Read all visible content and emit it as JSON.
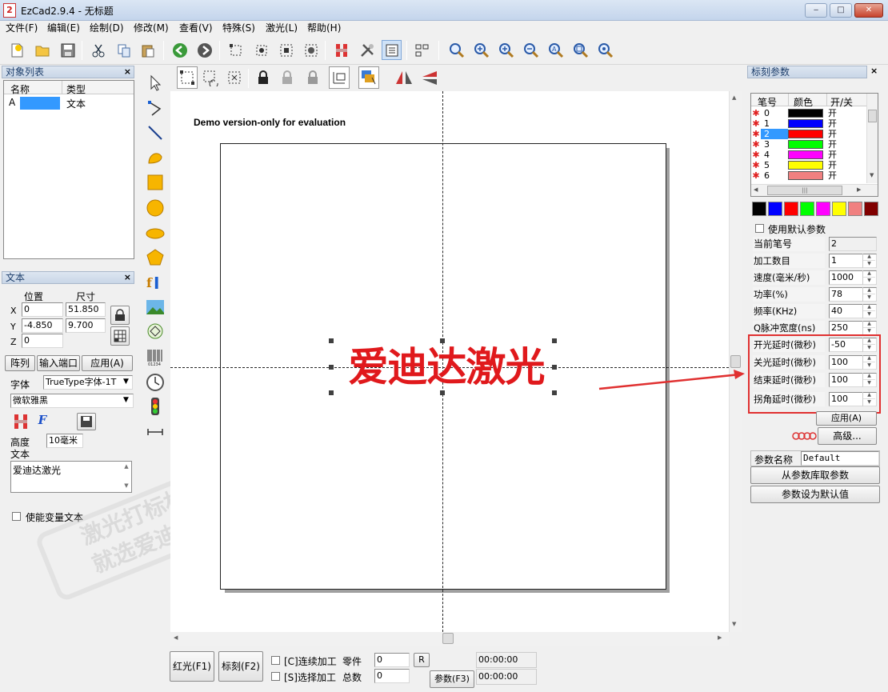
{
  "window": {
    "title": "EzCad2.9.4 - 无标题",
    "icon_text": "2",
    "min": "‒",
    "max": "□",
    "close": "✕"
  },
  "menu": [
    "文件(F)",
    "编辑(E)",
    "绘制(D)",
    "修改(M)",
    "查看(V)",
    "特殊(S)",
    "激光(L)",
    "帮助(H)"
  ],
  "object_list": {
    "title": "对象列表",
    "col_name": "名称",
    "col_type": "类型",
    "rows": [
      {
        "name": "A",
        "type": "文本"
      }
    ]
  },
  "text_panel": {
    "title": "文本",
    "pos_label": "位置",
    "size_label": "尺寸",
    "x_label": "X",
    "y_label": "Y",
    "z_label": "Z",
    "x": "0",
    "y": "-4.850",
    "z": "0",
    "w": "51.850",
    "h": "9.700",
    "btn_array": "阵列",
    "btn_input_port": "输入端口",
    "btn_apply": "应用(A)",
    "font_label": "字体",
    "font_type": "TrueType字体-1T",
    "font_name": "微软雅黑",
    "height_label": "高度",
    "height_value": "10毫米",
    "text_label": "文本",
    "text_value": "爱迪达激光",
    "variable_text": "使能变量文本"
  },
  "watermark": {
    "line1": "激光打标机",
    "line2": "就选爱迪达"
  },
  "canvas": {
    "demo_text": "Demo version-only for evaluation",
    "main_text": "爱迪达激光",
    "text_color": "#e0191c"
  },
  "bottom": {
    "red_light": "红光(F1)",
    "mark": "标刻(F2)",
    "continuous": "[C]连续加工",
    "selected": "[S]选择加工",
    "parts_label": "零件",
    "parts_value": "0",
    "total_label": "总数",
    "total_value": "0",
    "r_button": "R",
    "params_button": "参数(F3)",
    "time1": "00:00:00",
    "time2": "00:00:00"
  },
  "marking": {
    "title": "标刻参数",
    "col_pen": "笔号",
    "col_color": "颜色",
    "col_onoff": "开/关",
    "pens": [
      {
        "num": "0",
        "color": "#000000",
        "state": "开"
      },
      {
        "num": "1",
        "color": "#0000ff",
        "state": "开"
      },
      {
        "num": "2",
        "color": "#ff0000",
        "state": "开"
      },
      {
        "num": "3",
        "color": "#00ff00",
        "state": "开"
      },
      {
        "num": "4",
        "color": "#ff00ff",
        "state": "开"
      },
      {
        "num": "5",
        "color": "#ffff00",
        "state": "开"
      },
      {
        "num": "6",
        "color": "#f08080",
        "state": "开"
      }
    ],
    "selected_pen": "2",
    "palette": [
      "#000000",
      "#0000ff",
      "#ff0000",
      "#00ff00",
      "#ff00ff",
      "#ffff00",
      "#f08080",
      "#800000"
    ],
    "use_default": "使用默认参数",
    "current_pen_label": "当前笔号",
    "current_pen": "2",
    "params": [
      {
        "label": "加工数目",
        "value": "1"
      },
      {
        "label": "速度(毫米/秒)",
        "value": "1000"
      },
      {
        "label": "功率(%)",
        "value": "78"
      },
      {
        "label": "频率(KHz)",
        "value": "40"
      },
      {
        "label": "Q脉冲宽度(ns)",
        "value": "250"
      }
    ],
    "delays": [
      {
        "label": "开光延时(微秒)",
        "value": "-50"
      },
      {
        "label": "关光延时(微秒)",
        "value": "100"
      },
      {
        "label": "结束延时(微秒)",
        "value": "100"
      },
      {
        "label": "拐角延时(微秒)",
        "value": "100"
      }
    ],
    "apply": "应用(A)",
    "advanced": "高级...",
    "param_name_label": "参数名称",
    "param_name": "Default",
    "from_library": "从参数库取参数",
    "set_default": "参数设为默认值",
    "highlight_color": "#e03030"
  }
}
